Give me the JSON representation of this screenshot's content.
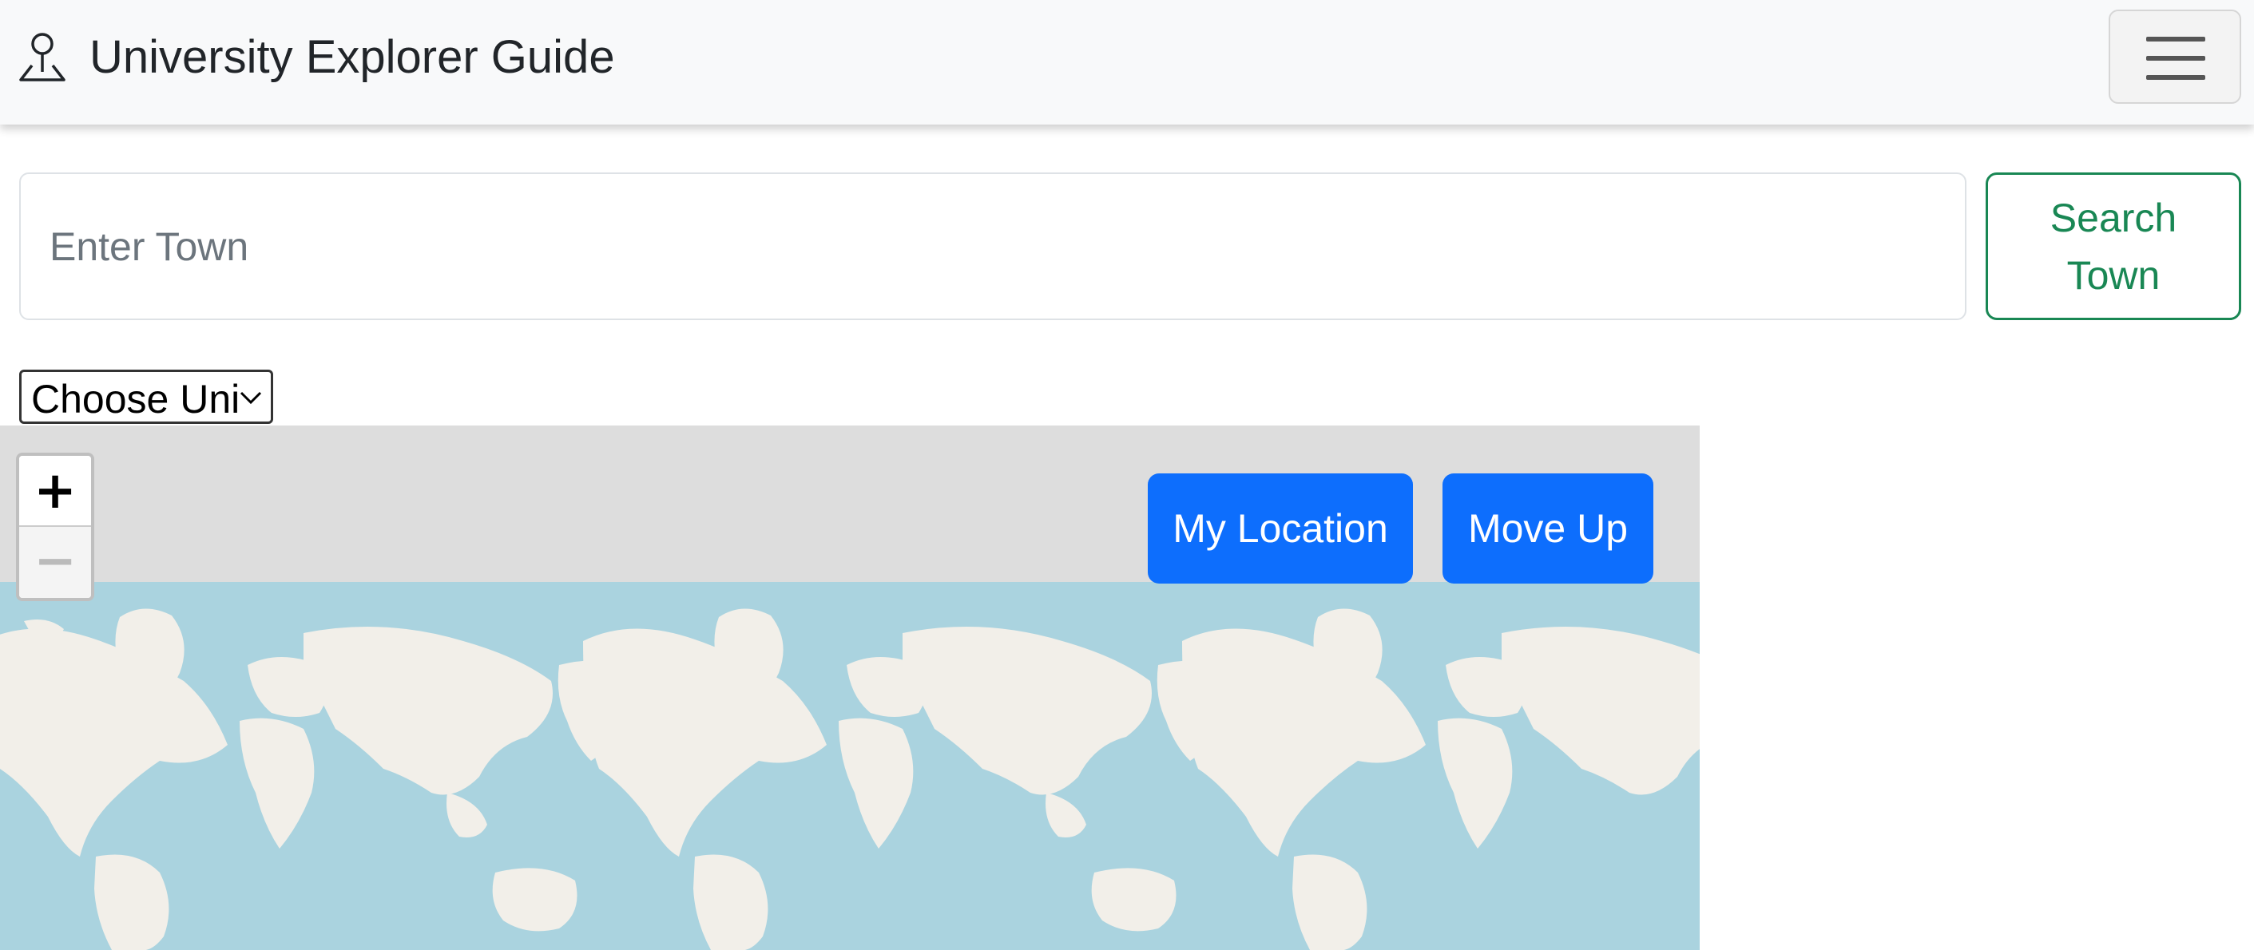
{
  "navbar": {
    "title": "University Explorer Guide",
    "brand_icon": "person-pin-icon",
    "menu_icon": "hamburger-menu-icon"
  },
  "search": {
    "placeholder": "Enter Town",
    "value": "",
    "button_label": "Search Town"
  },
  "uni_select": {
    "selected": "Choose Uni",
    "icon": "chevron-down-icon"
  },
  "map": {
    "zoom_in": "+",
    "zoom_out": "−",
    "my_location_label": "My Location",
    "move_up_label": "Move Up"
  },
  "colors": {
    "navbar_bg": "#f8f9fa",
    "primary": "#0d6efd",
    "success": "#198754",
    "ocean": "#aad3df",
    "land": "#f2efe9",
    "map_empty": "#dddddd"
  }
}
